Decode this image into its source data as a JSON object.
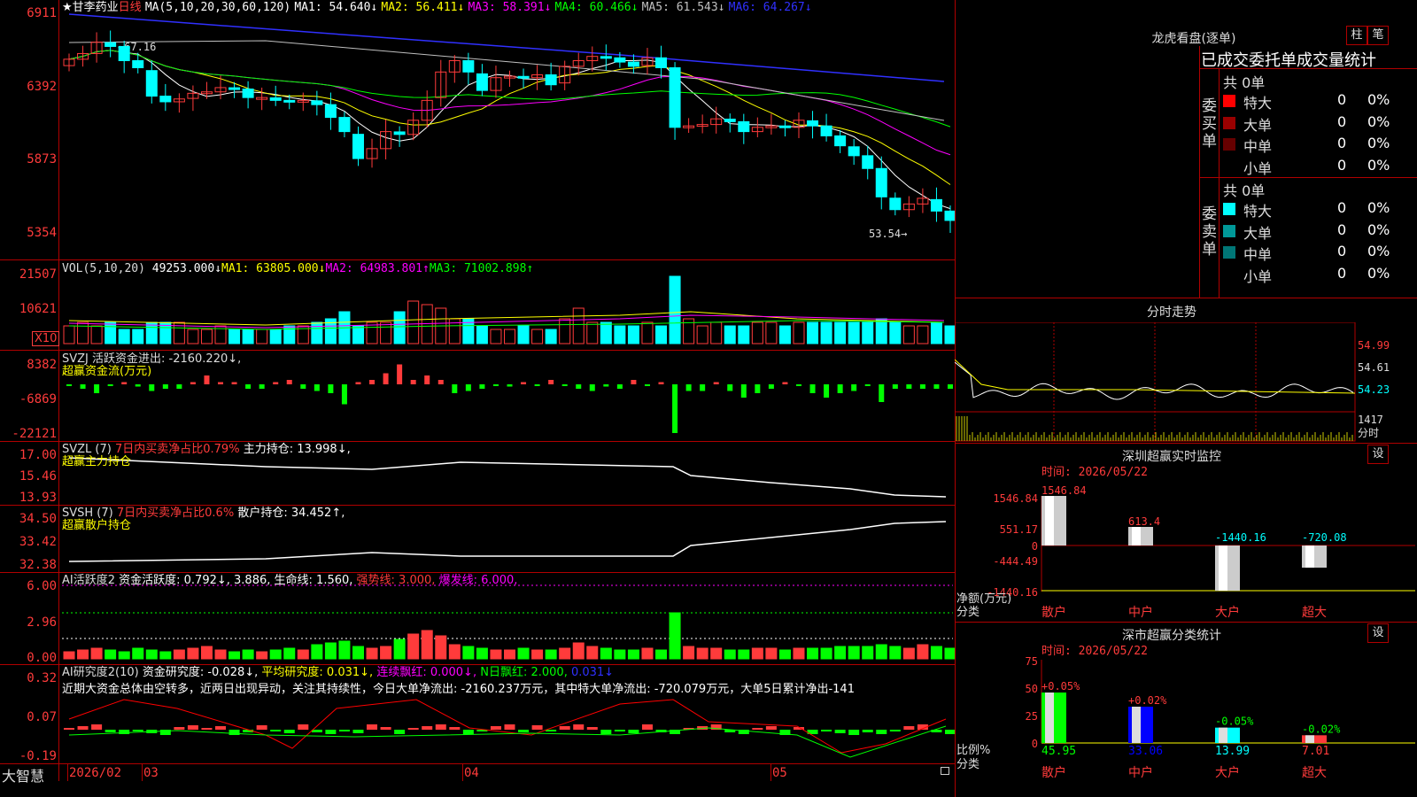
{
  "main_chart": {
    "title_stock": "甘李药业",
    "title_period": "日线",
    "star": "★",
    "ma_params": "MA(5,10,20,30,60,120)",
    "ma": [
      {
        "label": "MA1: 54.640↓",
        "color": "#ffffff"
      },
      {
        "label": "MA2: 56.411↓",
        "color": "#ffff00"
      },
      {
        "label": "MA3: 58.391↓",
        "color": "#ff00ff"
      },
      {
        "label": "MA4: 60.466↓",
        "color": "#00ff00"
      },
      {
        "label": "MA5: 61.543↓",
        "color": "#c0c0c0"
      },
      {
        "label": "MA6: 64.267↓",
        "color": "#3030ff"
      }
    ],
    "y_ticks": [
      "6911",
      "6392",
      "5873",
      "5354"
    ],
    "high_mark": "←67.16",
    "low_mark": "53.54→"
  },
  "vol": {
    "params": "VOL(5,10,20)",
    "value": "49253.000↓",
    "ma1": "MA1: 63805.000↓",
    "ma2": "MA2: 64983.801↑",
    "ma3": "MA3: 71002.898↑",
    "y_ticks": [
      "21507",
      "10621"
    ],
    "unit": "X10"
  },
  "svzj": {
    "line1": "SVZJ  活跃资金进出: -2160.220↓,",
    "line2": "超赢资金流(万元)",
    "y_ticks": [
      "8382",
      "-6869",
      "-22121"
    ]
  },
  "svzl": {
    "prefix": "SVZL (7)",
    "ratio": "7日内买卖净占比0.79%",
    "hold": "主力持仓: 13.998↓,",
    "line2": "超赢主力持仓",
    "y_ticks": [
      "17.00",
      "15.46",
      "13.93"
    ]
  },
  "svsh": {
    "prefix": "SVSH (7)",
    "ratio": "7日内买卖净占比0.6%",
    "hold": "散户持仓: 34.452↑,",
    "line2": "超赢散户持仓",
    "y_ticks": [
      "34.50",
      "33.42",
      "32.38"
    ]
  },
  "ai_active": {
    "prefix": "AI活跃度2",
    "a": "资金活跃度: 0.792↓, 3.886,",
    "life": "生命线: 1.560,",
    "strong": "强势线: 3.000,",
    "burst": "爆发线: 6.000,",
    "y_ticks": [
      "6.00",
      "2.96",
      "0.00"
    ]
  },
  "ai_research": {
    "prefix": "AI研究度2(10)",
    "a": "资金研究度: -0.028↓,",
    "avg": "平均研究度: 0.031↓,",
    "cont": "连续飘红: 0.000↓,",
    "nday": "N日飘红: 2.000,",
    "tail": "0.031↓",
    "comment": "近期大资金总体由空转多，近两日出现异动，关注其持续性，今日大单净流出: -2160.237万元，其中特大单净流出: -720.079万元，大单5日累计净出-141",
    "y_ticks": [
      "0.32",
      "0.07",
      "-0.19"
    ]
  },
  "bottom_bar": {
    "brand": "大智慧",
    "dates": [
      "2026/02",
      "03",
      "04",
      "05"
    ]
  },
  "right_panel": {
    "dragon_title": "龙虎看盘(逐单)",
    "btn_zhu": "柱",
    "btn_bi": "笔",
    "stats_title": "已成交委托单成交量统计",
    "buy_label": "委买单",
    "sell_label": "委卖单",
    "buy_total": "共 0单",
    "sell_total": "共 0单",
    "buy_rows": [
      {
        "name": "特大",
        "val": "0",
        "pct": "0%",
        "color": "#ff0000"
      },
      {
        "name": "大单",
        "val": "0",
        "pct": "0%",
        "color": "#990000"
      },
      {
        "name": "中单",
        "val": "0",
        "pct": "0%",
        "color": "#660000"
      },
      {
        "name": "小单",
        "val": "0",
        "pct": "0%",
        "color": ""
      }
    ],
    "sell_rows": [
      {
        "name": "特大",
        "val": "0",
        "pct": "0%",
        "color": "#00ffff"
      },
      {
        "name": "大单",
        "val": "0",
        "pct": "0%",
        "color": "#009999"
      },
      {
        "name": "中单",
        "val": "0",
        "pct": "0%",
        "color": "#007777"
      },
      {
        "name": "小单",
        "val": "0",
        "pct": "0%",
        "color": ""
      }
    ],
    "intraday_title": "分时走势",
    "intraday_ticks": [
      "54.99",
      "54.61",
      "54.23"
    ],
    "intraday_vol": "1417",
    "intraday_vol_unit": "分时",
    "monitor_title": "深圳超赢实时监控",
    "monitor_time": "时间: 2026/05/22",
    "monitor_btn": "设",
    "monitor_yticks": [
      "1546.84",
      "551.17",
      "0",
      "-444.49",
      "-1440.16"
    ],
    "monitor_ylabel": "净额(万元)",
    "monitor_xlabel": "分类",
    "monitor_bars": [
      {
        "name": "散户",
        "value": "1546.84"
      },
      {
        "name": "中户",
        "value": "613.4"
      },
      {
        "name": "大户",
        "value": "-1440.16"
      },
      {
        "name": "超大",
        "value": "-720.08"
      }
    ],
    "class_title": "深市超赢分类统计",
    "class_time": "时间: 2026/05/22",
    "class_btn": "设",
    "class_yticks": [
      "75",
      "50",
      "25",
      "0"
    ],
    "class_ylabel": "比例%",
    "class_xlabel": "分类",
    "class_bars": [
      {
        "name": "散户",
        "pct": "+0.05%",
        "value": "45.95"
      },
      {
        "name": "中户",
        "pct": "+0.02%",
        "value": "33.06"
      },
      {
        "name": "大户",
        "pct": "-0.05%",
        "value": "13.99"
      },
      {
        "name": "超大",
        "pct": "-0.02%",
        "value": "7.01"
      }
    ]
  },
  "colors": {
    "up": "#ff3b3b",
    "down": "#00ffff",
    "grid": "#b00000"
  }
}
